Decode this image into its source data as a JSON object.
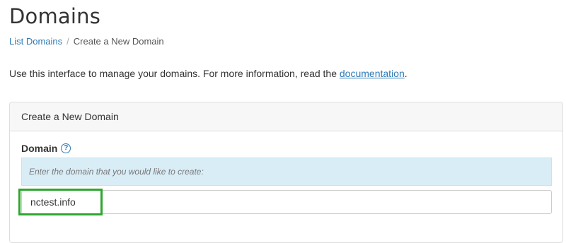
{
  "header": {
    "title": "Domains"
  },
  "breadcrumb": {
    "items": [
      {
        "label": "List Domains"
      },
      {
        "label": "Create a New Domain"
      }
    ],
    "separator": "/"
  },
  "intro": {
    "text": "Use this interface to manage your domains. For more information, read the ",
    "link_label": "documentation",
    "suffix": "."
  },
  "panel": {
    "heading": "Create a New Domain",
    "field_label": "Domain",
    "help_icon": "question-circle-icon",
    "help_glyph": "?",
    "info_text": "Enter the domain that you would like to create:",
    "domain_value": "nctest.info"
  },
  "colors": {
    "link": "#2f7ab5",
    "info_bg": "#d9edf7",
    "highlight": "#2ea62e"
  }
}
